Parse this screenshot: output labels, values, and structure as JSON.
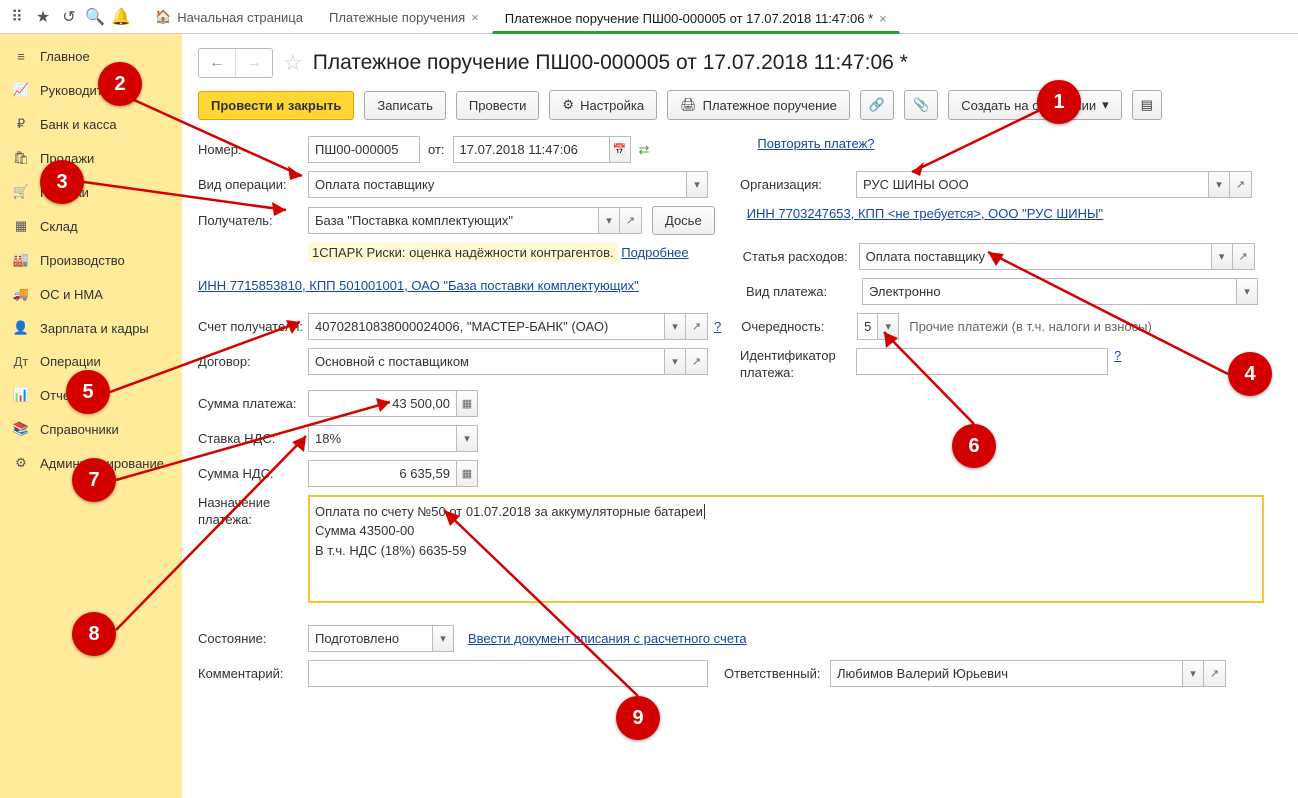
{
  "tabs": {
    "home": "Начальная страница",
    "list": "Платежные поручения",
    "doc": "Платежное поручение ПШ00-000005 от 17.07.2018 11:47:06 *"
  },
  "sidebar": [
    "Главное",
    "Руководителю",
    "Банк и касса",
    "Продажи",
    "Покупки",
    "Склад",
    "Производство",
    "ОС и НМА",
    "Зарплата и кадры",
    "Операции",
    "Отчеты",
    "Справочники",
    "Администрирование"
  ],
  "title": "Платежное поручение ПШ00-000005 от 17.07.2018 11:47:06 *",
  "buttons": {
    "process_close": "Провести и закрыть",
    "save": "Записать",
    "process": "Провести",
    "settings": "Настройка",
    "print": "Платежное поручение",
    "createbased": "Создать на основании"
  },
  "labels": {
    "number": "Номер:",
    "from": "от:",
    "repeat_link": "Повторять платеж?",
    "op_type": "Вид операции:",
    "org": "Организация:",
    "recipient": "Получатель:",
    "dossier": "Досье",
    "inn_link": "ИНН 7703247653, КПП <не требуется>, ООО \"РУС ШИНЫ\"",
    "spark": "1СПАРК Риски: оценка надёжности контрагентов.",
    "more": "Подробнее",
    "expense": "Статья расходов:",
    "payer_link": "ИНН 7715853810, КПП 501001001, ОАО \"База поставки комплектующих\"",
    "pay_type": "Вид платежа:",
    "rcpt_account": "Счет получателя:",
    "priority": "Очередность:",
    "priority_note": "Прочие платежи (в т.ч. налоги и взносы)",
    "contract": "Договор:",
    "pay_ident": "Идентификатор платежа:",
    "amount": "Сумма платежа:",
    "vat_rate": "Ставка НДС:",
    "vat_sum": "Сумма НДС:",
    "purpose": "Назначение платежа:",
    "status": "Состояние:",
    "enter_doc": "Ввести документ списания с расчетного счета",
    "comment": "Комментарий:",
    "responsible": "Ответственный:"
  },
  "values": {
    "number": "ПШ00-000005",
    "date": "17.07.2018 11:47:06",
    "op_type": "Оплата поставщику",
    "org": "РУС ШИНЫ ООО",
    "recipient": "База \"Поставка комплектующих\"",
    "expense": "Оплата поставщику",
    "pay_type": "Электронно",
    "rcpt_account": "40702810838000024006, \"МАСТЕР-БАНК\" (ОАО)",
    "priority": "5",
    "contract": "Основной с поставщиком",
    "amount": "43 500,00",
    "vat_rate": "18%",
    "vat_sum": "6 635,59",
    "purpose1": "Оплата по счету №50 от 01.07.2018 за аккумуляторные батареи",
    "purpose2": "Сумма 43500-00",
    "purpose3": "В т.ч. НДС  (18%) 6635-59",
    "status": "Подготовлено",
    "responsible": "Любимов Валерий Юрьевич"
  }
}
